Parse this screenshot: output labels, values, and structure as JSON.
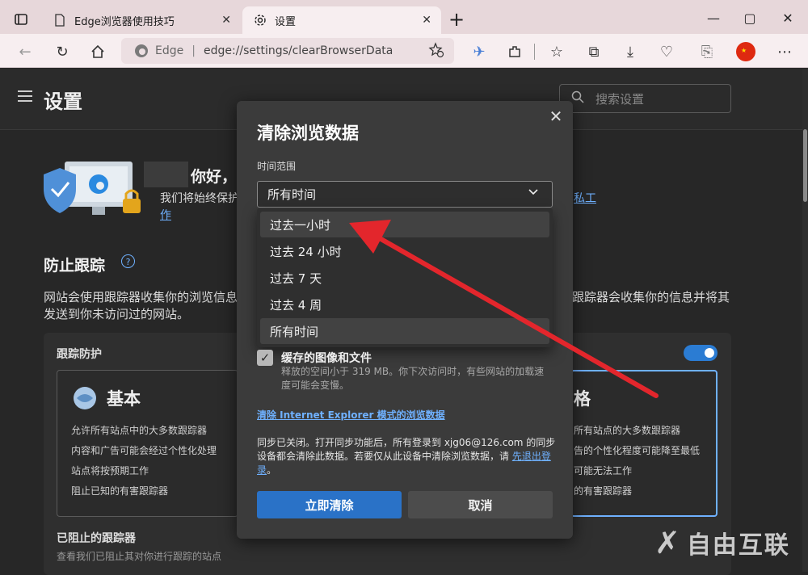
{
  "browser": {
    "tabs": [
      {
        "label": "Edge浏览器使用技巧",
        "icon": "page-icon"
      },
      {
        "label": "设置",
        "icon": "gear-icon"
      }
    ],
    "new_tab": "+",
    "address": {
      "site": "Edge",
      "separator": "|",
      "url": "edge://settings/clearBrowserData"
    }
  },
  "settings": {
    "title": "设置",
    "search_placeholder": "搜索设置",
    "greeting": "你好，",
    "greeting_line_start": "我们将始终保护",
    "greeting_line_end": "私工",
    "greeting_line2": "作",
    "tracking_title": "防止跟踪",
    "tracking_help": "?",
    "tracking_desc_start": "网站会使用跟踪器收集你的浏览信息。",
    "tracking_desc_end": "跟踪器会收集你的信息并将其",
    "tracking_desc_line2": "发送到你未访问过的网站。",
    "protection_title": "跟踪防护",
    "basic": {
      "title": "基本",
      "bullets": [
        "允许所有站点中的大多数跟踪器",
        "内容和广告可能会经过个性化处理",
        "站点将按预期工作",
        "阻止已知的有害跟踪器"
      ]
    },
    "strict": {
      "title": "格",
      "bullets": [
        "所有站点的大多数跟踪器",
        "告的个性化程度可能降至最低",
        "可能无法工作",
        "的有害跟踪器"
      ]
    },
    "blocked_title": "已阻止的跟踪器",
    "blocked_desc": "查看我们已阻止其对你进行跟踪的站点"
  },
  "dialog": {
    "title": "清除浏览数据",
    "close": "✕",
    "time_range_label": "时间范围",
    "selected": "所有时间",
    "options": [
      "过去一小时",
      "过去 24 小时",
      "过去 7 天",
      "过去 4 周",
      "所有时间"
    ],
    "cache_title": "缓存的图像和文件",
    "cache_desc": "释放的空间小于 319 MB。你下次访问时，有些网站的加载速度可能会变慢。",
    "ie_link": "清除 Internet Explorer 模式的浏览数据",
    "sync_text": "同步已关闭。打开同步功能后，所有登录到 xjg06@126.com 的同步设备都会清除此数据。若要仅从此设备中清除浏览数据，请 ",
    "sync_link": "先退出登录",
    "sync_end": "。",
    "clear_button": "立即清除",
    "cancel_button": "取消"
  },
  "watermark": "自由互联",
  "colors": {
    "accent": "#2a72c7",
    "arrow": "#e3262c",
    "toggle": "#2b7cd3"
  }
}
